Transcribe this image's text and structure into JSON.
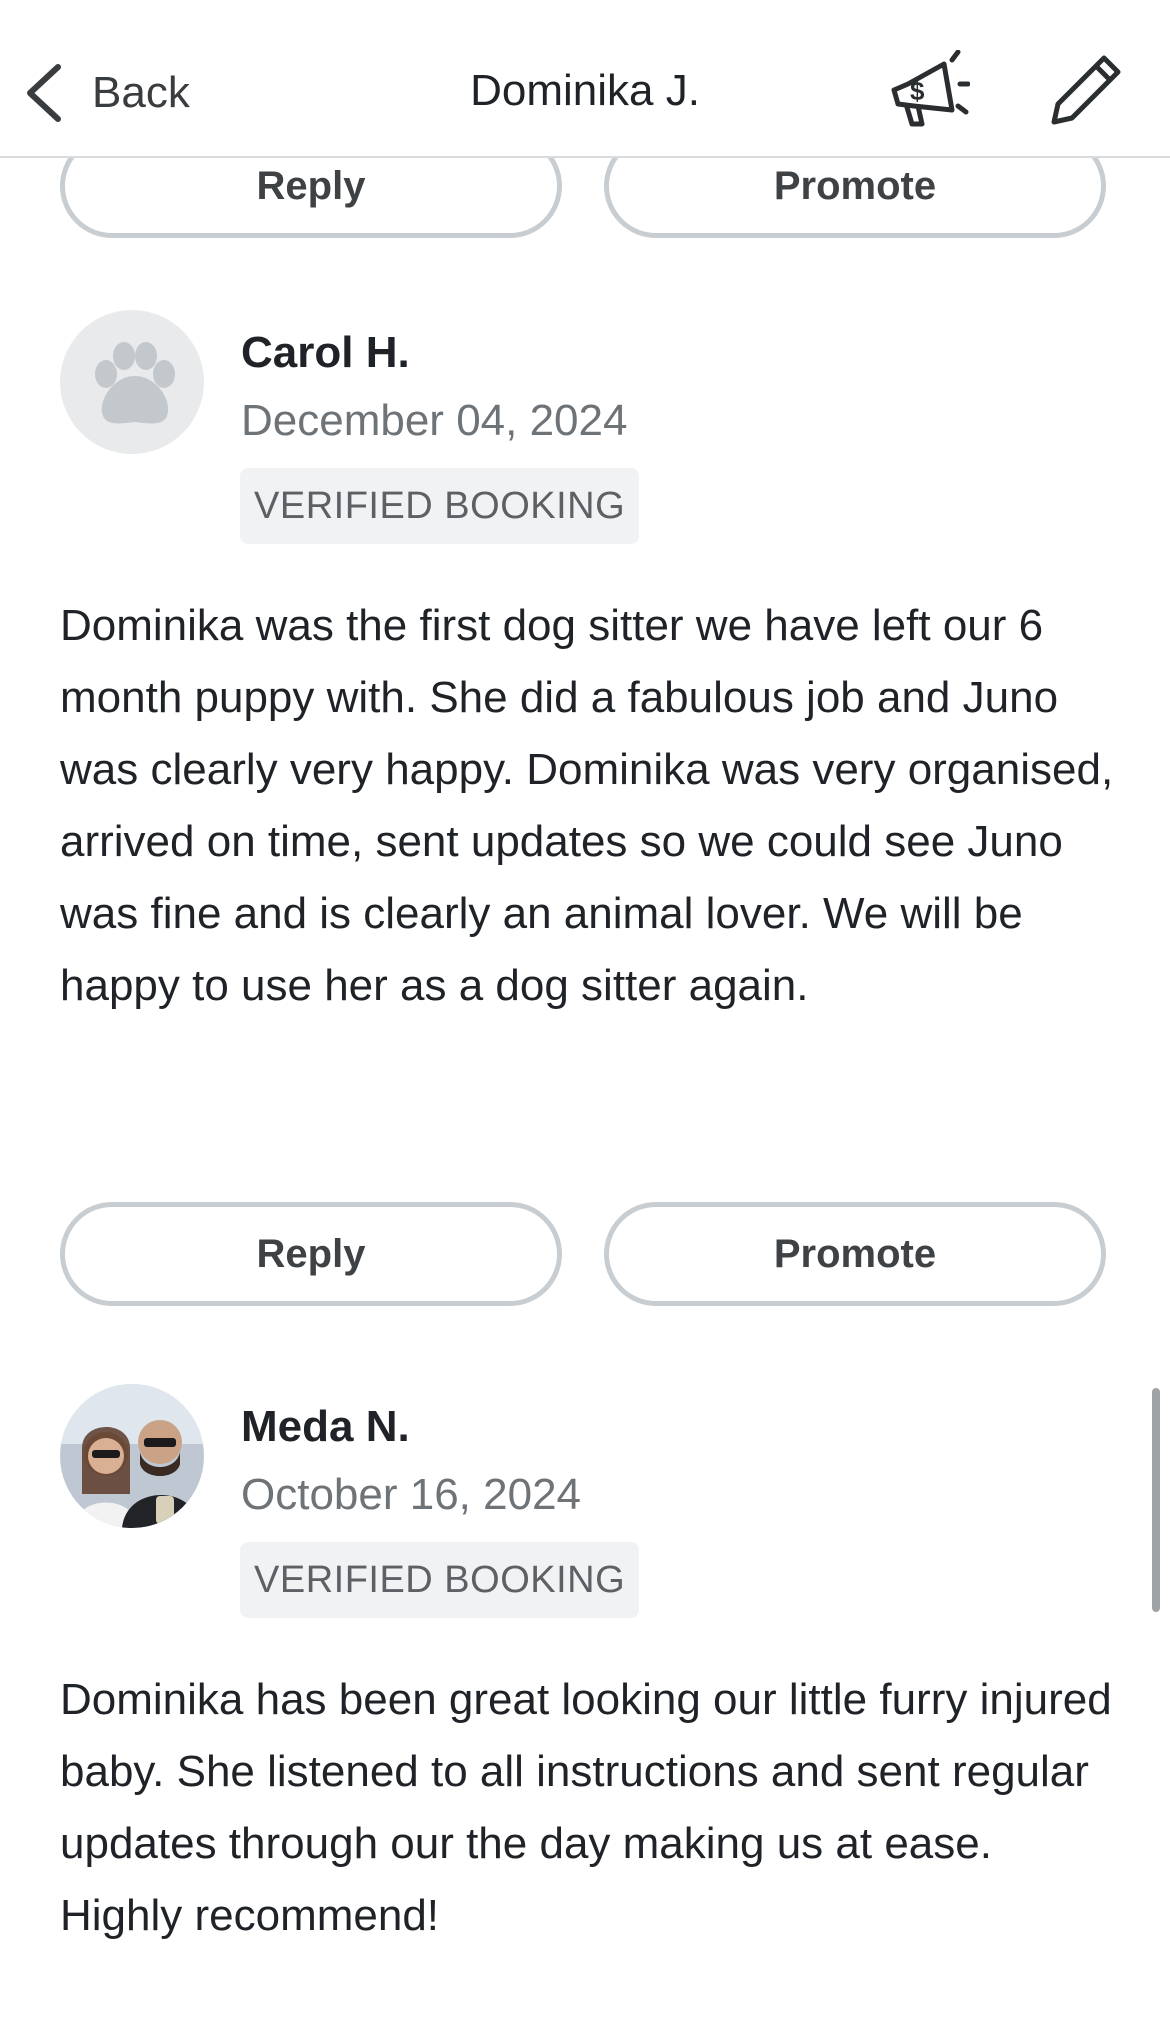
{
  "nav": {
    "back_label": "Back",
    "title": "Dominika J.",
    "promote_icon": "megaphone-dollar-icon",
    "edit_icon": "pencil-icon"
  },
  "actions": {
    "reply_label": "Reply",
    "promote_label": "Promote"
  },
  "reviews": [
    {
      "name": "Carol H.",
      "date": "December 04, 2024",
      "badge": "VERIFIED BOOKING",
      "avatar_icon": "paw-icon",
      "body": "Dominika was the first dog sitter we have left our 6 month puppy with. She did a fabulous job and Juno was clearly very happy. Dominika was very organised, arrived on time, sent updates so we could see Juno was fine and is clearly an animal lover. We will be happy to use her as a dog sitter again."
    },
    {
      "name": "Meda N.",
      "date": "October 16, 2024",
      "badge": "VERIFIED BOOKING",
      "avatar_icon": "user-photo",
      "body": "Dominika has been great looking our little furry injured baby. She listened to all instructions and sent regular updates through our the day making us at ease. Highly recommend!"
    }
  ],
  "colors": {
    "text": "#1f2328",
    "muted": "#6e7378",
    "border": "#c8cdd1",
    "badge_bg": "#f1f2f3"
  }
}
